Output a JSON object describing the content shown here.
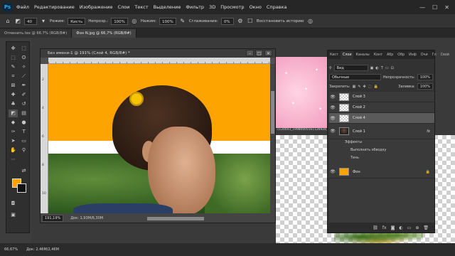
{
  "app": {
    "logo": "Ps"
  },
  "menubar": {
    "items": [
      "Файл",
      "Редактирование",
      "Изображение",
      "Слои",
      "Текст",
      "Выделение",
      "Фильтр",
      "3D",
      "Просмотр",
      "Окно",
      "Справка"
    ],
    "window_controls": [
      "—",
      "☐",
      "✕"
    ]
  },
  "options_bar": {
    "home_icon": "home-icon",
    "brush_size": "40",
    "mode_label": "Режим:",
    "mode_value": "Кисть",
    "opacity_label": "Непрозр.:",
    "opacity_value": "100%",
    "pressure_label": "Нажим:",
    "pressure_value": "100%",
    "smoothing_label": "Сглаживание:",
    "smoothing_value": "0%",
    "history_label": "Восстановить историю"
  },
  "doc_tabs": [
    {
      "label": "Отменить.tex @ 66.7% (RGB/8#)",
      "active": false
    },
    {
      "label": "Фон N.jpg @ 66,7% (RGB/8#)",
      "active": true
    }
  ],
  "document": {
    "title": "Без имени-1 @ 191% (Слой 4, RGB/8#) *",
    "zoom": "191,19%",
    "info": "Док: 1,93М/6,30М",
    "ruler_v": [
      "2",
      "4",
      "6",
      "8",
      "10"
    ]
  },
  "pink_document": {
    "filename": "c120003_19980005561126928_3"
  },
  "panel": {
    "tabs": [
      "Кист",
      "Слои",
      "Каналы",
      "Конт",
      "Абр",
      "Обр",
      "Инф",
      "Очи",
      "Гл",
      "Свой"
    ],
    "active_tab": "Слои",
    "kind_label": "Вид",
    "blend_mode": "Обычные",
    "opacity_label": "Непрозрачность:",
    "opacity_value": "100%",
    "lock_label": "Закрепить:",
    "fill_label": "Заливка:",
    "fill_value": "100%",
    "layers": [
      {
        "name": "Слой 3",
        "selected": false,
        "thumb": "checker"
      },
      {
        "name": "Слой 2",
        "selected": false,
        "thumb": "checker"
      },
      {
        "name": "Слой 4",
        "selected": true,
        "thumb": "checker"
      },
      {
        "name": "Слой 1",
        "selected": false,
        "thumb": "dark",
        "fx": "fx"
      },
      {
        "name": "Фон",
        "selected": false,
        "thumb": "orange",
        "lock": "🔒"
      }
    ],
    "effects_label": "Эффекты",
    "effect_items": [
      "Выполнить обводку",
      "Тень"
    ],
    "bottom_icons": [
      "link-icon",
      "fx-icon",
      "mask-icon",
      "adjustment-icon",
      "group-icon",
      "new-layer-icon",
      "trash-icon"
    ]
  },
  "status": {
    "zoom": "66,67%",
    "doc": "Док: 2,46М/2,46М"
  },
  "colors": {
    "foreground": "#fea400",
    "background": "#111111",
    "accent": "#fea400"
  }
}
